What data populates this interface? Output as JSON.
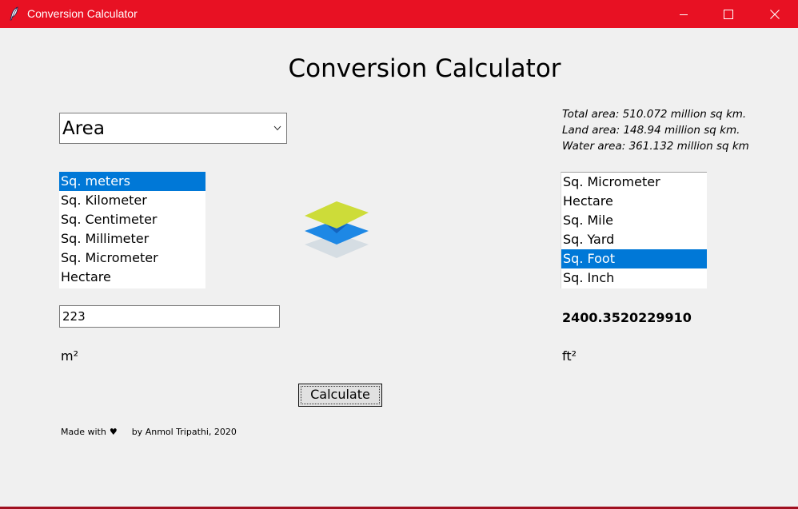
{
  "window": {
    "title": "Conversion Calculator",
    "accent_color": "#e81123",
    "controls": {
      "minimize_icon": "minimize-icon",
      "maximize_icon": "maximize-icon",
      "close_icon": "close-icon"
    }
  },
  "header": {
    "title": "Conversion Calculator"
  },
  "category_select": {
    "value": "Area"
  },
  "earth_info": {
    "total": "Total area: 510.072 million sq km.",
    "land": "Land area: 148.94 million sq km.",
    "water": "Water area: 361.132 million sq km"
  },
  "from_units": {
    "items": [
      "Sq. meters",
      "Sq. Kilometer",
      "Sq. Centimeter",
      "Sq. Millimeter",
      "Sq. Micrometer",
      "Hectare"
    ],
    "selected_index": 0
  },
  "to_units": {
    "items": [
      "Sq. Micrometer",
      "Hectare",
      "Sq. Mile",
      "Sq. Yard",
      "Sq. Foot",
      "Sq. Inch"
    ],
    "selected_index": 4
  },
  "center_icon": "layers-icon",
  "input": {
    "value": "223"
  },
  "result": {
    "value": "2400.3520229910"
  },
  "units": {
    "from_symbol": "m²",
    "to_symbol": "ft²"
  },
  "actions": {
    "calculate_label": "Calculate"
  },
  "footer": {
    "made_with": "Made with",
    "heart": "♥",
    "author": "by Anmol Tripathi, 2020"
  },
  "colors": {
    "selection": "#0078d7",
    "background": "#f0f0f0"
  }
}
